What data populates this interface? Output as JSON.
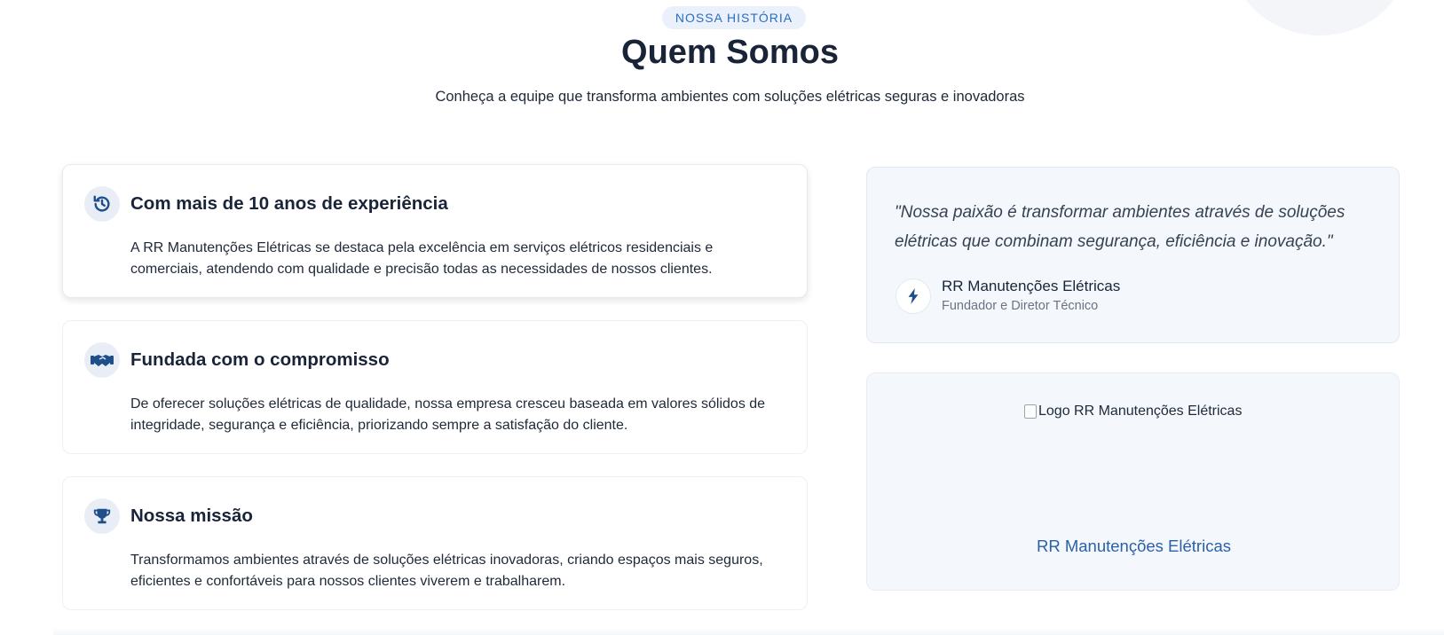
{
  "section": {
    "badge": "NOSSA HISTÓRIA",
    "title": "Quem Somos",
    "subtitle": "Conheça a equipe que transforma ambientes com soluções elétricas seguras e inovadoras"
  },
  "cards": [
    {
      "icon": "history-icon",
      "title": "Com mais de 10 anos de experiência",
      "body": "A RR Manutenções Elétricas se destaca pela excelência em serviços elétricos residenciais e comerciais, atendendo com qualidade e precisão todas as necessidades de nossos clientes."
    },
    {
      "icon": "handshake-icon",
      "title": "Fundada com o compromisso",
      "body": "De oferecer soluções elétricas de qualidade, nossa empresa cresceu baseada em valores sólidos de integridade, segurança e eficiência, priorizando sempre a satisfação do cliente."
    },
    {
      "icon": "trophy-icon",
      "title": "Nossa missão",
      "body": "Transformamos ambientes através de soluções elétricas inovadoras, criando espaços mais seguros, eficientes e confortáveis para nossos clientes viverem e trabalharem."
    }
  ],
  "quote": {
    "text": "\"Nossa paixão é transformar ambientes através de soluções elétricas que combinam segurança, eficiência e inovação.\"",
    "author_icon": "bolt-icon",
    "author": "RR Manutenções Elétricas",
    "role": "Fundador e Diretor Técnico"
  },
  "logo": {
    "alt": "Logo RR Manutenções Elétricas",
    "caption": "RR Manutenções Elétricas"
  },
  "colors": {
    "accent": "#2b6cc4",
    "icon": "#1e4f8a",
    "heading": "#1a2438",
    "panel_bg": "#f4f8fd"
  }
}
